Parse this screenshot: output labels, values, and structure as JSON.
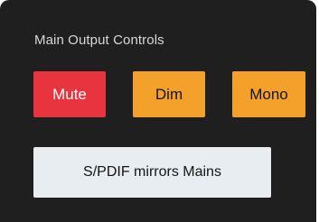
{
  "panel": {
    "title": "Main Output Controls"
  },
  "buttons": {
    "mute": {
      "label": "Mute",
      "state": "active",
      "color": "#e8343f"
    },
    "dim": {
      "label": "Dim",
      "color": "#f4a12c"
    },
    "mono": {
      "label": "Mono",
      "color": "#f4a12c"
    },
    "spdif": {
      "label": "S/PDIF mirrors Mains",
      "color": "#e7edf0"
    }
  },
  "colors": {
    "panel_background": "#1f1f1f",
    "title_text": "#d8d8d8"
  }
}
